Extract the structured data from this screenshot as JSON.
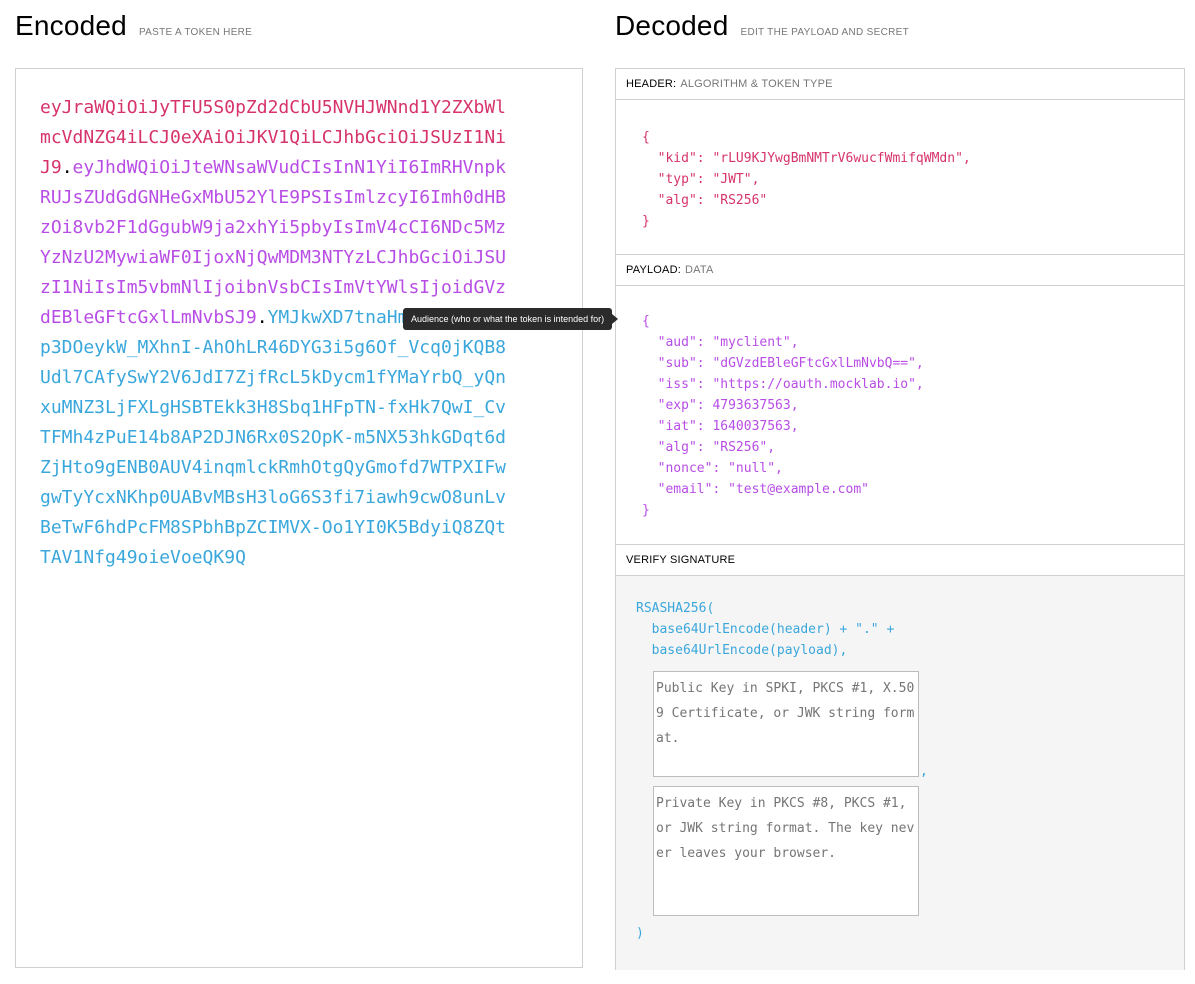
{
  "encoded": {
    "title": "Encoded",
    "hint": "PASTE A TOKEN HERE",
    "token_header": "eyJraWQiOiJyTFU5S0pZd2dCbU5NVHJWNnd1Y2ZXbWlmcVdNZG4iLCJ0eXAiOiJKV1QiLCJhbGciOiJSUzI1NiJ9",
    "token_payload": "eyJhdWQiOiJteWNsaWVudCIsInN1YiI6ImRHVnpkRUJsZUdGdGNHeGxMbU52YlE9PSIsImlzcyI6Imh0dHBzOi8vb2F1dGgubW9ja2xhYi5pbyIsImV4cCI6NDc5MzYzNzU2MywiaWF0IjoxNjQwMDM3NTYzLCJhbGciOiJSUzI1NiIsIm5vbmNlIjoibnVsbCIsImVtYWlsIjoidGVzdEBleGFtcGxlLmNvbSJ9",
    "token_signature": "YMJkwXD7tnaHmmyQfD10-kp3DOeykW_MXhnI-AhOhLR46DYG3i5g6Of_Vcq0jKQB8Udl7CAfySwY2V6JdI7ZjfRcL5kDycm1fYMaYrbQ_yQnxuMNZ3LjFXLgHSBTEkk3H8Sbq1HFpTN-fxHk7QwI_CvTFMh4zPuE14b8AP2DJN6Rx0S2OpK-m5NX53hkGDqt6dZjHto9gENB0AUV4inqmlckRmhOtgQyGmofd7WTPXIFwgwTyYcxNKhp0UABvMBsH3loG6S3fi7iawh9cwO8unLvBeTwF6hdPcFM8SPbhBpZCIMVX-Oo1YI0K5BdyiQ8ZQtTAV1Nfg49oieVoeQK9Q",
    "dot": "."
  },
  "tooltip": "Audience (who or what the token is intended for)",
  "decoded": {
    "title": "Decoded",
    "hint": "EDIT THE PAYLOAD AND SECRET",
    "header": {
      "label": "HEADER:",
      "sub": "ALGORITHM & TOKEN TYPE",
      "lines": [
        "{",
        "  \"kid\": \"rLU9KJYwgBmNMTrV6wucfWmifqWMdn\",",
        "  \"typ\": \"JWT\",",
        "  \"alg\": \"RS256\"",
        "}"
      ]
    },
    "payload": {
      "label": "PAYLOAD:",
      "sub": "DATA",
      "lines": [
        "{",
        "  \"aud\": \"myclient\",",
        "  \"sub\": \"dGVzdEBleGFtcGxlLmNvbQ==\",",
        "  \"iss\": \"https://oauth.mocklab.io\",",
        "  \"exp\": 4793637563,",
        "  \"iat\": 1640037563,",
        "  \"alg\": \"RS256\",",
        "  \"nonce\": \"null\",",
        "  \"email\": \"test@example.com\"",
        "}"
      ]
    },
    "verify": {
      "label": "VERIFY SIGNATURE",
      "lines": [
        "RSASHA256(",
        "  base64UrlEncode(header) + \".\" +",
        "  base64UrlEncode(payload),"
      ],
      "public_key_placeholder": "Public Key in SPKI, PKCS #1, X.509 Certificate, or JWK string format.",
      "private_key_placeholder": "Private Key in PKCS #8, PKCS #1, or JWK string format. The key never leaves your browser.",
      "comma": ",",
      "close": ")"
    }
  }
}
